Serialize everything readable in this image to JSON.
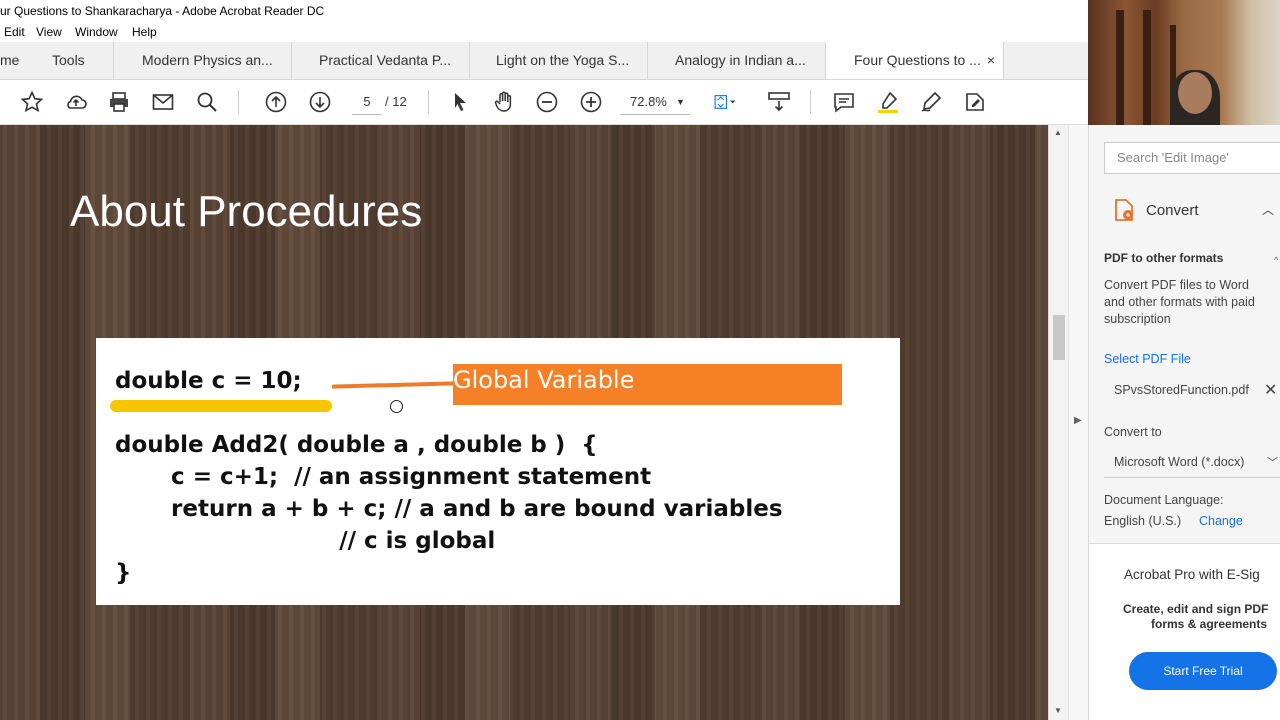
{
  "window": {
    "title": "ur Questions to Shankaracharya - Adobe Acrobat Reader DC"
  },
  "menu": [
    "Edit",
    "View",
    "Window",
    "Help"
  ],
  "tabs": {
    "home": "me",
    "tools": "Tools",
    "docs": [
      {
        "label": "Modern Physics an..."
      },
      {
        "label": "Practical Vedanta P..."
      },
      {
        "label": "Light on the Yoga S..."
      },
      {
        "label": "Analogy in Indian a..."
      },
      {
        "label": "Four Questions to ..."
      }
    ],
    "close": "×"
  },
  "toolbar": {
    "page_current": "5",
    "page_total": "/ 12",
    "zoom": "72.8%"
  },
  "slide": {
    "title": "About Procedures",
    "code_lines": [
      "double c = 10;",
      "double Add2( double a , double b )  {",
      "       c = c+1;  // an assignment statement",
      "       return a + b + c; // a and b are bound variables",
      "                            // c is global",
      "}"
    ],
    "annotation": "Global Variable",
    "colors": {
      "highlight": "#f7c600",
      "annotation": "#f58025"
    }
  },
  "panel": {
    "search_placeholder": "Search 'Edit Image'",
    "convert_title": "Convert",
    "pdf_formats_heading": "PDF to other formats",
    "pdf_formats_desc": [
      "Convert PDF files to Word",
      "and other formats with paid",
      "subscription"
    ],
    "select_file_link": "Select PDF File",
    "selected_file": "SPvsStoredFunction.pdf",
    "convert_to_label": "Convert to",
    "convert_to_value": "Microsoft Word (*.docx)",
    "doc_language_label": "Document Language:",
    "doc_language_value": "English (U.S.)",
    "change_link": "Change",
    "promo_title": "Acrobat Pro with E-Sig",
    "promo_desc": [
      "Create, edit and sign PDF",
      "forms & agreements"
    ],
    "trial_button": "Start Free Trial",
    "accent": "#1473e6"
  }
}
